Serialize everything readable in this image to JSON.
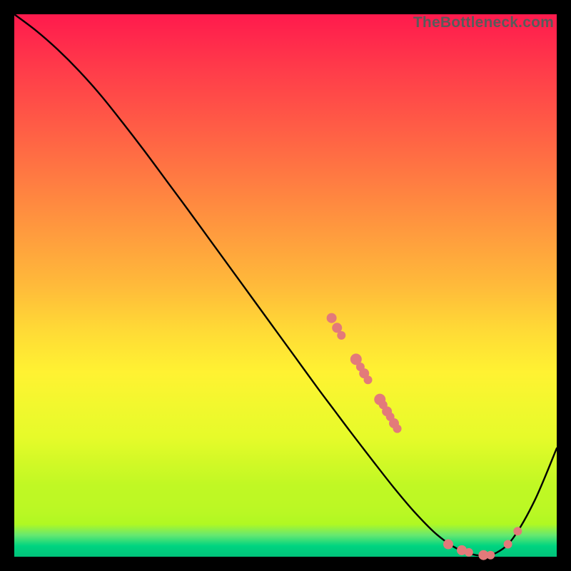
{
  "watermark": "TheBottleneck.com",
  "chart_data": {
    "type": "line",
    "title": "",
    "xlabel": "",
    "ylabel": "",
    "xlim": [
      0,
      100
    ],
    "ylim": [
      0,
      100
    ],
    "series": [
      {
        "name": "bottleneck-curve",
        "x": [
          0,
          4,
          8,
          12,
          16,
          20,
          24,
          28,
          32,
          36,
          40,
          44,
          48,
          52,
          56,
          59,
          62,
          66,
          70,
          74,
          78,
          82,
          86,
          89,
          92,
          96,
          100
        ],
        "y": [
          100,
          97,
          93.5,
          89.5,
          85,
          80,
          74.8,
          69.4,
          64,
          58.5,
          53,
          47.5,
          42,
          36.5,
          31,
          27,
          23,
          17.8,
          12.7,
          8,
          4,
          1.3,
          0.2,
          0.8,
          3.5,
          10.5,
          20
        ]
      }
    ],
    "scatter_points": {
      "name": "highlighted-points",
      "color": "#e37a7a",
      "points": [
        {
          "x": 58.5,
          "y": 44.0,
          "r": 7
        },
        {
          "x": 59.5,
          "y": 42.2,
          "r": 7
        },
        {
          "x": 60.3,
          "y": 40.8,
          "r": 6
        },
        {
          "x": 63.0,
          "y": 36.4,
          "r": 8
        },
        {
          "x": 63.8,
          "y": 35.0,
          "r": 6
        },
        {
          "x": 64.5,
          "y": 33.8,
          "r": 7
        },
        {
          "x": 65.2,
          "y": 32.6,
          "r": 6
        },
        {
          "x": 67.4,
          "y": 29.0,
          "r": 8
        },
        {
          "x": 68.0,
          "y": 28.0,
          "r": 6
        },
        {
          "x": 68.7,
          "y": 26.8,
          "r": 7
        },
        {
          "x": 69.3,
          "y": 25.8,
          "r": 6
        },
        {
          "x": 70.0,
          "y": 24.6,
          "r": 7
        },
        {
          "x": 70.6,
          "y": 23.6,
          "r": 6
        },
        {
          "x": 80.0,
          "y": 2.3,
          "r": 7
        },
        {
          "x": 82.5,
          "y": 1.2,
          "r": 7
        },
        {
          "x": 83.8,
          "y": 0.8,
          "r": 6
        },
        {
          "x": 86.5,
          "y": 0.3,
          "r": 7
        },
        {
          "x": 87.8,
          "y": 0.3,
          "r": 6
        },
        {
          "x": 91.0,
          "y": 2.3,
          "r": 6
        },
        {
          "x": 92.8,
          "y": 4.7,
          "r": 6
        }
      ]
    }
  }
}
